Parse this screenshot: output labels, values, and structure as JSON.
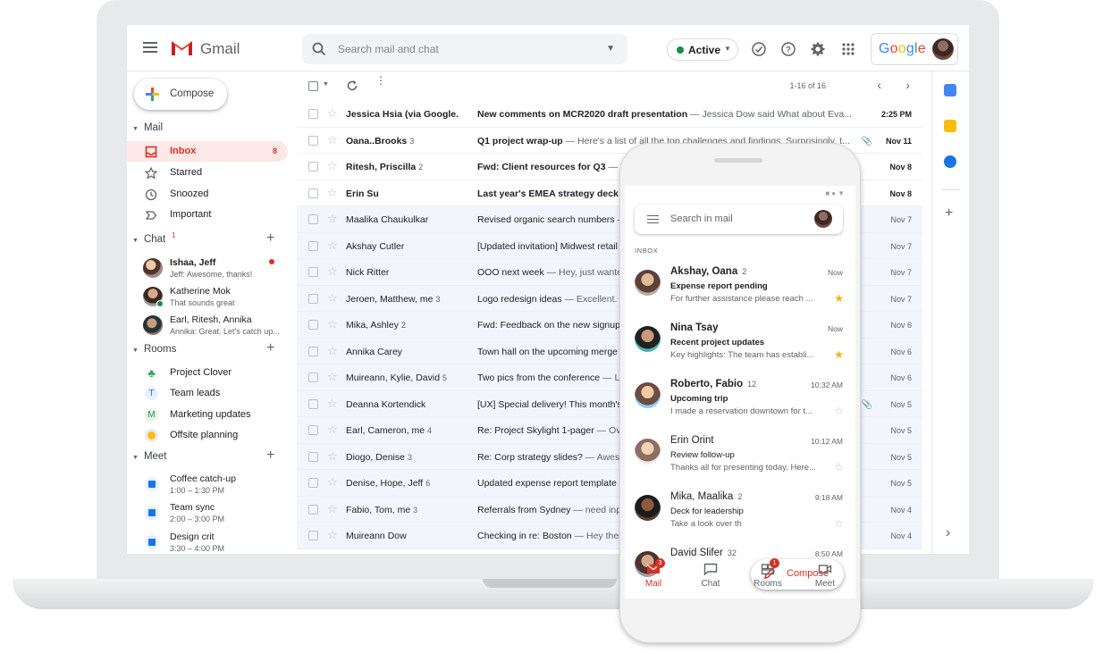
{
  "app": {
    "name": "Gmail"
  },
  "header": {
    "search_placeholder": "Search mail and chat",
    "status": "Active",
    "google_word": "Google"
  },
  "sidebar": {
    "compose_label": "Compose",
    "mail_title": "Mail",
    "mail_items": [
      {
        "label": "Inbox",
        "count": "8"
      },
      {
        "label": "Starred"
      },
      {
        "label": "Snoozed"
      },
      {
        "label": "Important"
      }
    ],
    "chat_title": "Chat",
    "chat_badge": "1",
    "chats": [
      {
        "name": "Ishaa, Jeff",
        "message": "Jeff: Awesome, thanks!"
      },
      {
        "name": "Katherine Mok",
        "message": "That sounds great"
      },
      {
        "name": "Earl, Ritesh, Annika",
        "message": "Annika: Great. Let's catch up..."
      }
    ],
    "rooms_title": "Rooms",
    "rooms": [
      {
        "label": "Project Clover",
        "icon": "clover-icon"
      },
      {
        "label": "Team leads",
        "icon": "T"
      },
      {
        "label": "Marketing updates",
        "icon": "M"
      },
      {
        "label": "Offsite planning",
        "icon": "offsite-icon"
      }
    ],
    "meet_title": "Meet",
    "meetings": [
      {
        "name": "Coffee catch-up",
        "time": "1:00 – 1:30 PM"
      },
      {
        "name": "Team sync",
        "time": "2:00 – 3:00 PM"
      },
      {
        "name": "Design crit",
        "time": "3:30 – 4:00 PM"
      }
    ]
  },
  "mail_list": {
    "pager": "1-16 of 16",
    "rows": [
      {
        "sender": "Jessica Hsia (via Google.",
        "count": "",
        "subject": "New comments on MCR2020 draft presentation",
        "snippet": " — Jessica Dow said What about Eva...",
        "date": "2:25 PM"
      },
      {
        "sender": "Oana..Brooks",
        "count": "3",
        "subject": "Q1 project wrap-up",
        "snippet": " — Here's a list of all the top challenges and findings. Surprisingly, t...",
        "date": "Nov 11"
      },
      {
        "sender": "Ritesh, Priscilla",
        "count": "2",
        "subject": "Fwd: Client resources for Q3",
        "snippet": " — Rit",
        "date": "Nov 8"
      },
      {
        "sender": "Erin Su",
        "count": "",
        "subject": "Last year's EMEA strategy deck",
        "snippet": " —",
        "date": "Nov 8"
      },
      {
        "sender": "Maalika Chaukulkar",
        "count": "",
        "subject": "Revised organic search numbers",
        "snippet": " —",
        "date": "Nov 7"
      },
      {
        "sender": "Akshay Cutler",
        "count": "",
        "subject": "[Updated invitation] Midwest retail",
        "snippet": "",
        "date": "Nov 7"
      },
      {
        "sender": "Nick Ritter",
        "count": "",
        "subject": "OOO next week",
        "snippet": " — Hey, just wanted",
        "date": "Nov 7"
      },
      {
        "sender": "Jeroen, Matthew, me",
        "count": "3",
        "subject": "Logo redesign ideas",
        "snippet": " — Excellent. D",
        "date": "Nov 7"
      },
      {
        "sender": "Mika, Ashley",
        "count": "2",
        "subject": "Fwd: Feedback on the new signup",
        "snippet": "",
        "date": "Nov 6"
      },
      {
        "sender": "Annika Carey",
        "count": "",
        "subject": "Town hall on the upcoming merge",
        "snippet": "",
        "date": "Nov 6"
      },
      {
        "sender": "Muireann, Kylie, David",
        "count": "5",
        "subject": "Two pics from the conference",
        "snippet": " — L",
        "date": "Nov 6"
      },
      {
        "sender": "Deanna Kortendick",
        "count": "",
        "subject": "[UX] Special delivery! This month's",
        "snippet": "",
        "date": "Nov 5"
      },
      {
        "sender": "Earl, Cameron, me",
        "count": "4",
        "subject": "Re: Project Skylight 1-pager",
        "snippet": " — Ove",
        "date": "Nov 5"
      },
      {
        "sender": "Diogo, Denise",
        "count": "3",
        "subject": "Re: Corp strategy slides?",
        "snippet": " — Aweso",
        "date": "Nov 5"
      },
      {
        "sender": "Denise, Hope, Jeff",
        "count": "6",
        "subject": "Updated expense report template",
        "snippet": "",
        "date": "Nov 5"
      },
      {
        "sender": "Fabio, Tom, me",
        "count": "3",
        "subject": "Referrals from Sydney",
        "snippet": " — need inpu",
        "date": "Nov 4"
      },
      {
        "sender": "Muireann Dow",
        "count": "",
        "subject": "Checking in re: Boston",
        "snippet": " — Hey there",
        "date": "Nov 4"
      }
    ]
  },
  "phone": {
    "search_placeholder": "Search in mail",
    "inbox_label": "INBOX",
    "messages": [
      {
        "from": "Akshay, Oana",
        "count": "2",
        "time": "Now",
        "subject": "Expense report pending",
        "snippet": "For further assistance please reach ...",
        "starred": true
      },
      {
        "from": "Nina Tsay",
        "count": "",
        "time": "Now",
        "subject": "Recent project updates",
        "snippet": "Key highlights:  The team has establi...",
        "starred": true
      },
      {
        "from": "Roberto, Fabio",
        "count": "12",
        "time": "10:32 AM",
        "subject": "Upcoming trip",
        "snippet": "I made a reservation downtown for t...",
        "starred": false
      },
      {
        "from": "Erin Orint",
        "count": "",
        "time": "10:12 AM",
        "subject": "Review follow-up",
        "snippet": "Thanks all for presenting today. Here...",
        "starred": false
      },
      {
        "from": "Mika, Maalika",
        "count": "2",
        "time": "9:18 AM",
        "subject": "Deck for leadership",
        "snippet": "Take a look over th",
        "starred": false
      },
      {
        "from": "David Slifer",
        "count": "32",
        "time": "8:50 AM",
        "subject": "",
        "snippet": "",
        "starred": false
      }
    ],
    "compose_label": "Compose",
    "tabs": [
      {
        "label": "Mail",
        "badge": "3"
      },
      {
        "label": "Chat",
        "badge": ""
      },
      {
        "label": "Rooms",
        "badge": "1"
      },
      {
        "label": "Meet",
        "badge": ""
      }
    ]
  },
  "colors": {
    "accent_red": "#d93025",
    "active_bg": "#fce8e6",
    "active_green": "#1e8e3e",
    "star_yellow": "#f4b400"
  }
}
